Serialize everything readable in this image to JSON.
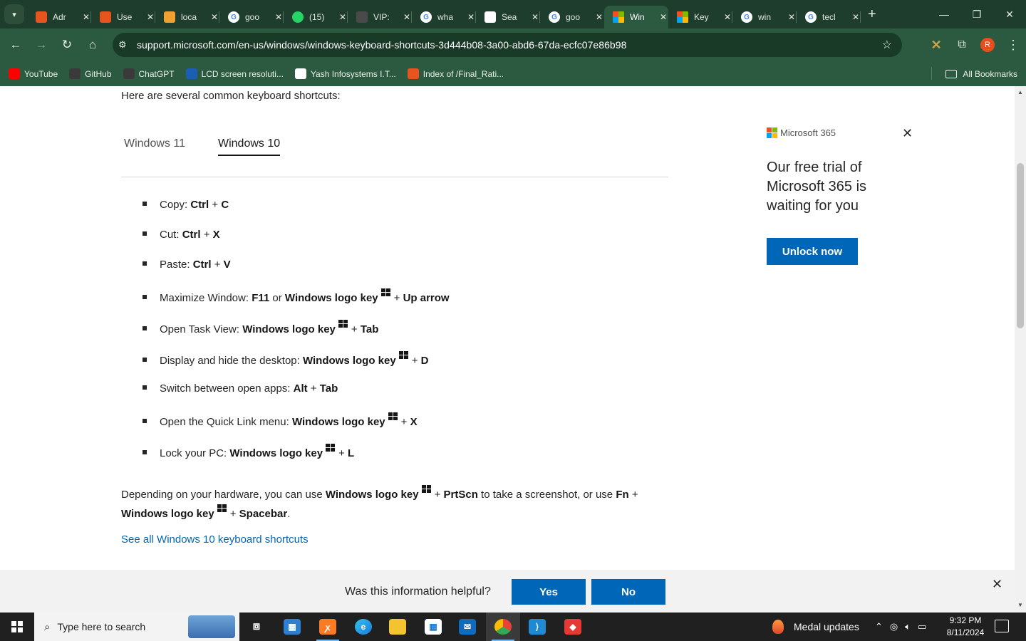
{
  "browser": {
    "tabs": [
      {
        "title": "Adr",
        "icon": "xampp-icon",
        "color": "#e8541e",
        "active": false
      },
      {
        "title": "Use",
        "icon": "xampp-icon",
        "color": "#e8541e",
        "active": false
      },
      {
        "title": "loca",
        "icon": "stripes-icon",
        "color": "#f0a030",
        "active": false
      },
      {
        "title": "goo",
        "icon": "google-icon",
        "color": "#ffffff",
        "active": false
      },
      {
        "title": "(15)",
        "icon": "whatsapp-icon",
        "color": "#25d366",
        "active": false
      },
      {
        "title": "VIP:",
        "icon": "vip-icon",
        "color": "#4a4a4a",
        "active": false
      },
      {
        "title": "wha",
        "icon": "google-icon",
        "color": "#ffffff",
        "active": false
      },
      {
        "title": "Sea",
        "icon": "azure-icon",
        "color": "#ffffff",
        "active": false
      },
      {
        "title": "goo",
        "icon": "google-icon",
        "color": "#ffffff",
        "active": false
      },
      {
        "title": "Win",
        "icon": "microsoft-icon",
        "color": "#f25022",
        "active": true
      },
      {
        "title": "Key",
        "icon": "microsoft-icon",
        "color": "#f25022",
        "active": false
      },
      {
        "title": "win",
        "icon": "google-icon",
        "color": "#ffffff",
        "active": false
      },
      {
        "title": "tecl",
        "icon": "google-icon",
        "color": "#ffffff",
        "active": false
      }
    ],
    "url": "support.microsoft.com/en-us/windows/windows-keyboard-shortcuts-3d444b08-3a00-abd6-67da-ecfc07e86b98",
    "profile_initial": "R",
    "bookmarks": [
      {
        "label": "YouTube",
        "color": "#ff0000"
      },
      {
        "label": "GitHub",
        "color": "#3a3a3a"
      },
      {
        "label": "ChatGPT",
        "color": "#3a3a3a"
      },
      {
        "label": "LCD screen resoluti...",
        "color": "#1a5fb4"
      },
      {
        "label": "Yash Infosystems I.T...",
        "color": "#ffffff"
      },
      {
        "label": "Index of /Final_Rati...",
        "color": "#e8541e"
      }
    ],
    "all_bookmarks": "All Bookmarks"
  },
  "page": {
    "intro": "Here are several common keyboard shortcuts:",
    "os_tabs": [
      "Windows 11",
      "Windows 10"
    ],
    "shortcuts": [
      {
        "label": "Copy: ",
        "keys": [
          {
            "k": "Ctrl"
          },
          {
            "p": " + "
          },
          {
            "k": "C"
          }
        ]
      },
      {
        "label": "Cut: ",
        "keys": [
          {
            "k": "Ctrl"
          },
          {
            "p": " + "
          },
          {
            "k": "X"
          }
        ]
      },
      {
        "label": "Paste: ",
        "keys": [
          {
            "k": "Ctrl"
          },
          {
            "p": " + "
          },
          {
            "k": "V"
          }
        ]
      },
      {
        "label": "Maximize Window: ",
        "keys": [
          {
            "k": "F11"
          },
          {
            "p": " or "
          },
          {
            "k": "Windows logo key"
          },
          {
            "w": true
          },
          {
            "p": "+ "
          },
          {
            "k": "Up arrow"
          }
        ]
      },
      {
        "label": "Open Task View: ",
        "keys": [
          {
            "k": "Windows logo key"
          },
          {
            "w": true
          },
          {
            "p": "+ "
          },
          {
            "k": "Tab"
          }
        ]
      },
      {
        "label": "Display and hide the desktop: ",
        "keys": [
          {
            "k": "Windows logo key"
          },
          {
            "w": true
          },
          {
            "p": "+ "
          },
          {
            "k": "D"
          }
        ]
      },
      {
        "label": "Switch between open apps: ",
        "keys": [
          {
            "k": "Alt"
          },
          {
            "p": " + "
          },
          {
            "k": "Tab"
          }
        ]
      },
      {
        "label": "Open the Quick Link menu: ",
        "keys": [
          {
            "k": "Windows logo key"
          },
          {
            "w": true
          },
          {
            "p": "+ "
          },
          {
            "k": "X"
          }
        ]
      },
      {
        "label": "Lock your PC: ",
        "keys": [
          {
            "k": "Windows logo key"
          },
          {
            "w": true
          },
          {
            "p": "+ "
          },
          {
            "k": "L"
          }
        ]
      }
    ],
    "paragraph": [
      {
        "p": "Depending on your hardware, you can use "
      },
      {
        "k": "Windows logo key"
      },
      {
        "w": true
      },
      {
        "p": "+ "
      },
      {
        "k": "PrtScn"
      },
      {
        "p": " to take a screenshot, or use "
      },
      {
        "k": "Fn"
      },
      {
        "p": " + "
      },
      {
        "br": true
      },
      {
        "k": "Windows logo key"
      },
      {
        "w": true
      },
      {
        "p": "+ "
      },
      {
        "k": "Spacebar"
      },
      {
        "p": "."
      }
    ],
    "see_all": "See all Windows 10 keyboard shortcuts"
  },
  "ad": {
    "brand": "Microsoft 365",
    "headline": "Our free trial of Microsoft 365 is waiting for you",
    "button": "Unlock now"
  },
  "feedback": {
    "question": "Was this information helpful?",
    "yes": "Yes",
    "no": "No"
  },
  "taskbar": {
    "search_placeholder": "Type here to search",
    "medal": "Medal updates",
    "time": "9:32 PM",
    "date": "8/11/2024"
  },
  "colors": {
    "accent": "#0067b8",
    "chrome_dark": "#1f3d2c",
    "chrome_mid": "#2c5a40"
  }
}
